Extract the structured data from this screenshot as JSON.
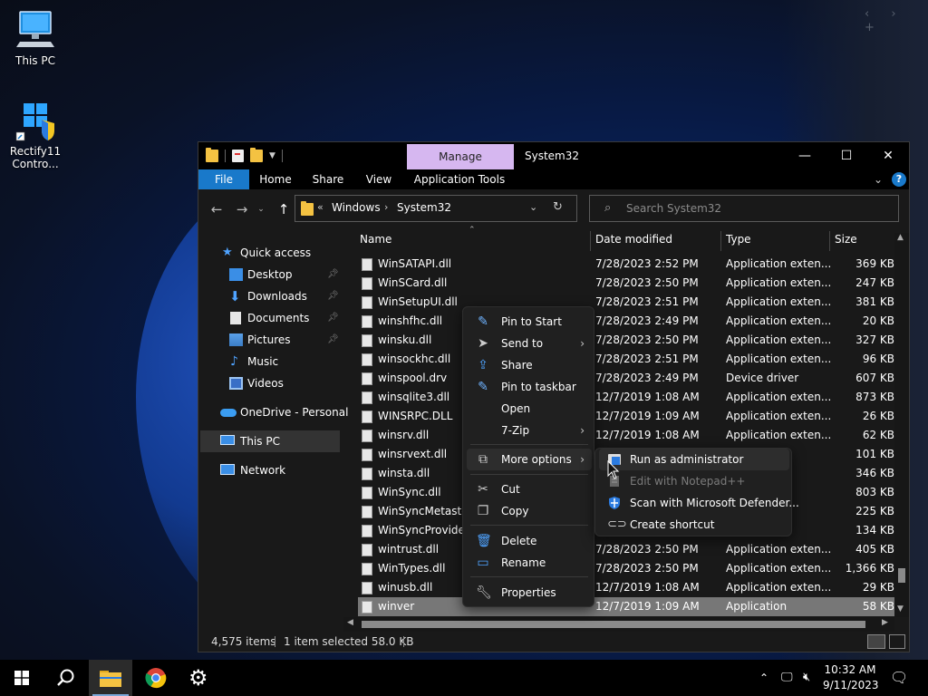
{
  "desktop": {
    "icons": [
      {
        "label": "This PC"
      },
      {
        "label": "Rectify11 Contro..."
      }
    ],
    "nav_arrows": "‹ › +"
  },
  "window": {
    "manage_tab": "Manage",
    "title": "System32",
    "ribbon_tabs": [
      "File",
      "Home",
      "Share",
      "View",
      "Application Tools"
    ],
    "address": {
      "path": [
        "Windows",
        "System32"
      ]
    },
    "search_placeholder": "Search System32",
    "nav_pane": {
      "items": [
        {
          "label": "Quick access",
          "pinned": false
        },
        {
          "label": "Desktop",
          "pinned": true
        },
        {
          "label": "Downloads",
          "pinned": true
        },
        {
          "label": "Documents",
          "pinned": true
        },
        {
          "label": "Pictures",
          "pinned": true
        },
        {
          "label": "Music",
          "pinned": false
        },
        {
          "label": "Videos",
          "pinned": false
        },
        {
          "label": "OneDrive - Personal",
          "pinned": false
        },
        {
          "label": "This PC",
          "pinned": false,
          "selected": true
        },
        {
          "label": "Network",
          "pinned": false
        }
      ]
    },
    "columns": [
      "Name",
      "Date modified",
      "Type",
      "Size"
    ],
    "files": [
      {
        "name": "WinSATAPI.dll",
        "date": "7/28/2023 2:52 PM",
        "type": "Application exten...",
        "size": "369 KB"
      },
      {
        "name": "WinSCard.dll",
        "date": "7/28/2023 2:50 PM",
        "type": "Application exten...",
        "size": "247 KB"
      },
      {
        "name": "WinSetupUI.dll",
        "date": "7/28/2023 2:51 PM",
        "type": "Application exten...",
        "size": "381 KB"
      },
      {
        "name": "winshfhc.dll",
        "date": "7/28/2023 2:49 PM",
        "type": "Application exten...",
        "size": "20 KB"
      },
      {
        "name": "winsku.dll",
        "date": "7/28/2023 2:50 PM",
        "type": "Application exten...",
        "size": "327 KB"
      },
      {
        "name": "winsockhc.dll",
        "date": "7/28/2023 2:51 PM",
        "type": "Application exten...",
        "size": "96 KB"
      },
      {
        "name": "winspool.drv",
        "date": "7/28/2023 2:49 PM",
        "type": "Device driver",
        "size": "607 KB"
      },
      {
        "name": "winsqlite3.dll",
        "date": "12/7/2019 1:08 AM",
        "type": "Application exten...",
        "size": "873 KB"
      },
      {
        "name": "WINSRPC.DLL",
        "date": "12/7/2019 1:09 AM",
        "type": "Application exten...",
        "size": "26 KB"
      },
      {
        "name": "winsrv.dll",
        "date": "12/7/2019 1:08 AM",
        "type": "Application exten...",
        "size": "62 KB"
      },
      {
        "name": "winsrvext.dll",
        "date": "",
        "type": "...ten...",
        "size": "101 KB"
      },
      {
        "name": "winsta.dll",
        "date": "",
        "type": "...ten...",
        "size": "346 KB"
      },
      {
        "name": "WinSync.dll",
        "date": "",
        "type": "...ten...",
        "size": "803 KB"
      },
      {
        "name": "WinSyncMetastore",
        "date": "",
        "type": "...ten...",
        "size": "225 KB"
      },
      {
        "name": "WinSyncProviders",
        "date": "",
        "type": "...ten...",
        "size": "134 KB"
      },
      {
        "name": "wintrust.dll",
        "date": "7/28/2023 2:50 PM",
        "type": "Application exten...",
        "size": "405 KB"
      },
      {
        "name": "WinTypes.dll",
        "date": "7/28/2023 2:50 PM",
        "type": "Application exten...",
        "size": "1,366 KB"
      },
      {
        "name": "winusb.dll",
        "date": "12/7/2019 1:08 AM",
        "type": "Application exten...",
        "size": "29 KB"
      },
      {
        "name": "winver",
        "date": "12/7/2019 1:09 AM",
        "type": "Application",
        "size": "58 KB",
        "selected": true
      }
    ],
    "status": {
      "items_count": "4,575 items",
      "selected": "1 item selected  58.0 KB"
    }
  },
  "context_menu": {
    "items": [
      {
        "label": "Pin to Start",
        "icon": "pin-icon"
      },
      {
        "label": "Send to",
        "icon": "send-icon",
        "submenu": true
      },
      {
        "label": "Share",
        "icon": "share-icon"
      },
      {
        "label": "Pin to taskbar",
        "icon": "pin-icon"
      },
      {
        "label": "Open",
        "icon": ""
      },
      {
        "label": "7-Zip",
        "icon": "",
        "submenu": true
      },
      {
        "label": "More options",
        "icon": "more-options-icon",
        "submenu": true,
        "hover": true
      },
      {
        "label": "Cut",
        "icon": "scissors-icon"
      },
      {
        "label": "Copy",
        "icon": "copy-icon"
      },
      {
        "label": "Delete",
        "icon": "trash-icon"
      },
      {
        "label": "Rename",
        "icon": "rename-icon"
      },
      {
        "label": "Properties",
        "icon": "wrench-icon"
      }
    ]
  },
  "submenu": {
    "items": [
      {
        "label": "Run as administrator",
        "hover": true
      },
      {
        "label": "Edit with Notepad++",
        "disabled": true
      },
      {
        "label": "Scan with Microsoft Defender...",
        "disabled": false
      },
      {
        "label": "Create shortcut",
        "disabled": false
      }
    ]
  },
  "taskbar": {
    "clock_time": "10:32 AM",
    "clock_date": "9/11/2023"
  }
}
